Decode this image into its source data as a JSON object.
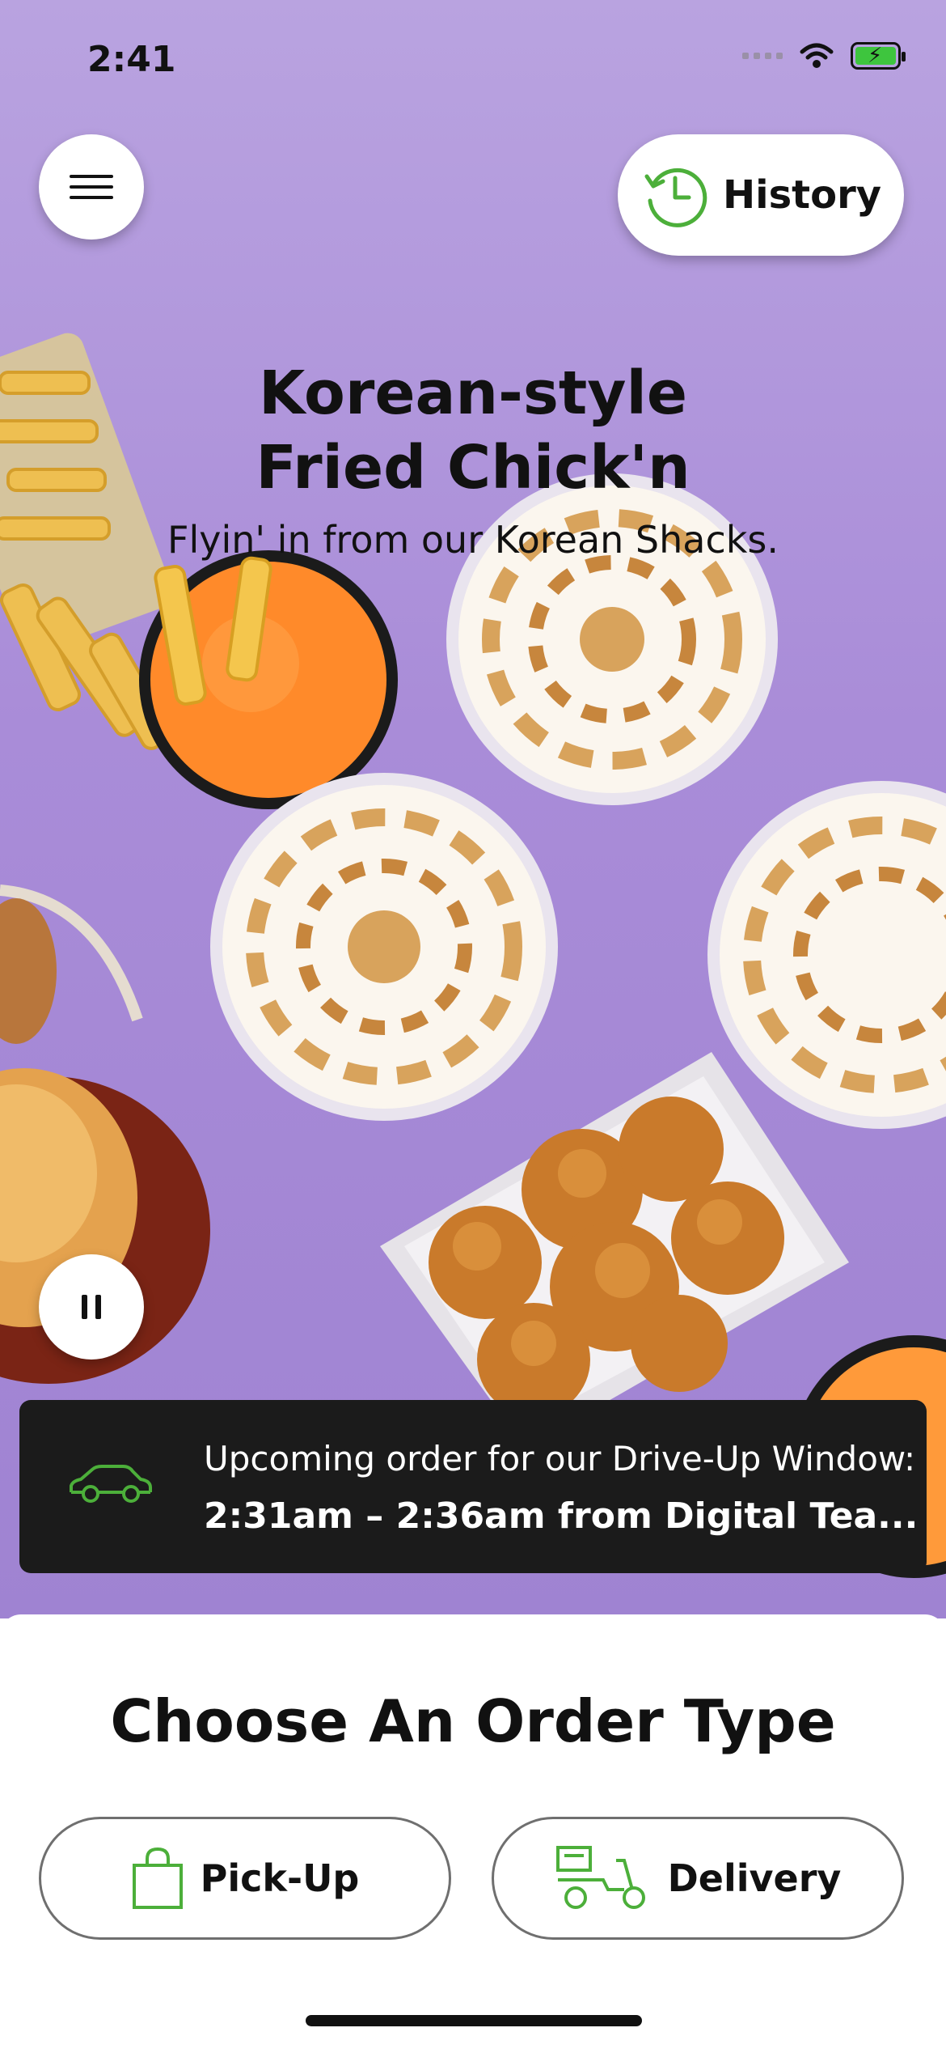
{
  "status_bar": {
    "time": "2:41"
  },
  "header": {
    "history_label": "History"
  },
  "hero": {
    "title_line1": "Korean-style",
    "title_line2": "Fried Chick'n",
    "subtitle": "Flyin' in from our Korean Shacks."
  },
  "order_banner": {
    "line1": "Upcoming order for our Drive-Up Window:",
    "line2": "2:31am – 2:36am from Digital Tea..."
  },
  "order_type": {
    "title": "Choose An Order Type",
    "pickup_label": "Pick-Up",
    "delivery_label": "Delivery"
  },
  "colors": {
    "accent_green": "#4caf3a",
    "hero_purple": "#a98cd8",
    "banner_dark": "#1b1b1b"
  },
  "icons": [
    "menu-icon",
    "history-clock-icon",
    "pause-icon",
    "car-icon",
    "shopping-bag-icon",
    "delivery-scooter-icon"
  ]
}
